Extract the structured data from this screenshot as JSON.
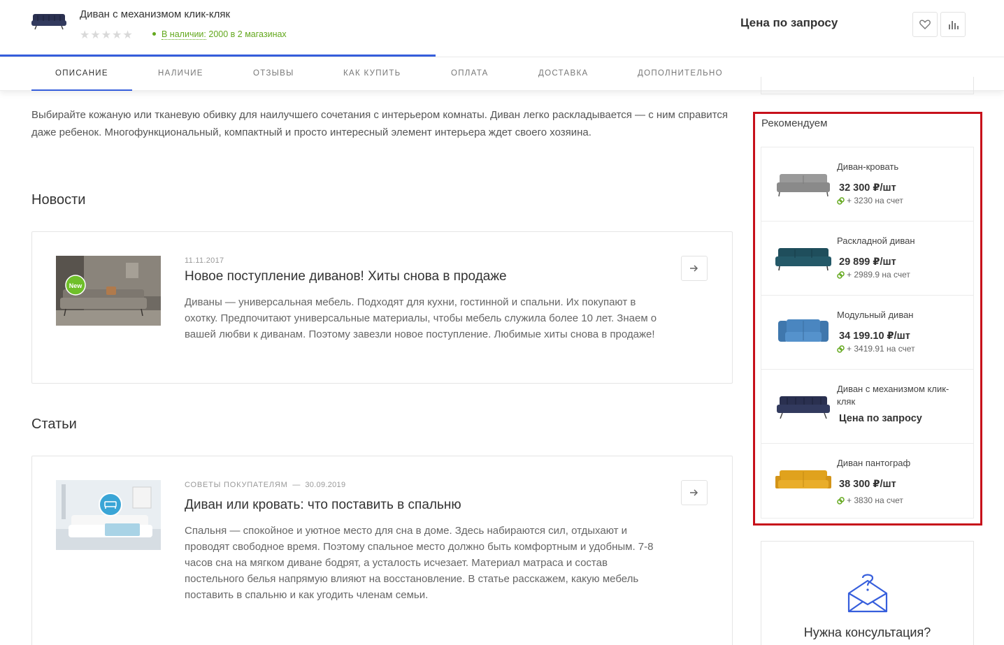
{
  "header": {
    "product_title": "Диван с механизмом клик-кляк",
    "rating_stars": "★★★★★",
    "stock_link": "В наличии:",
    "stock_rest": "2000 в 2 магазинах",
    "price": "Цена по запросу",
    "favorite_icon": "heart-icon",
    "compare_icon": "bar-chart-icon",
    "accent_color": "#365edc"
  },
  "tabs": [
    {
      "label": "ОПИСАНИЕ"
    },
    {
      "label": "НАЛИЧИЕ"
    },
    {
      "label": "ОТЗЫВЫ"
    },
    {
      "label": "КАК КУПИТЬ"
    },
    {
      "label": "ОПЛАТА"
    },
    {
      "label": "ДОСТАВКА"
    },
    {
      "label": "ДОПОЛНИТЕЛЬНО"
    }
  ],
  "description": "Выбирайте кожаную или тканевую обивку для наилучшего сочетания с интерьером комнаты. Диван легко раскладывается — с ним справится даже ребенок. Многофункциональный, компактный и просто интересный элемент интерьера ждет своего хозяина.",
  "news": {
    "heading": "Новости",
    "item": {
      "date": "11.11.2017",
      "badge": "New",
      "title": "Новое поступление диванов! Хиты снова в продаже",
      "text": "Диваны — универсальная мебель. Подходят для кухни, гостинной и спальни. Их покупают в охотку. Предпочитают универсальные материалы, чтобы мебель служила более 10 лет. Знаем о вашей любви к диванам. Поэтому завезли новое поступление. Любимые хиты снова в продаже!"
    }
  },
  "articles": {
    "heading": "Статьи",
    "item": {
      "section": "Советы покупателям",
      "separator": "—",
      "date": "30.09.2019",
      "title": "Диван или кровать: что поставить в спальню",
      "text": "Спальня — спокойное и уютное место для сна в доме. Здесь набираются сил, отдыхают и проводят свободное время. Поэтому спальное место должно быть комфортным и удобным. 7-8 часов сна на мягком диване бодрят, а усталость исчезает. Материал матраса и состав постельного белья напрямую влияют на восстановление. В статье расскажем, какую мебель поставить в спальню и как угодить членам семьи."
    }
  },
  "sidebar": {
    "recommend_title": "Рекомендуем",
    "items": [
      {
        "name": "Диван-кровать",
        "price": "32 300 ₽/шт",
        "bonus": "+ 3230 на счет",
        "color": "#9a9a9a"
      },
      {
        "name": "Раскладной диван",
        "price": "29 899 ₽/шт",
        "bonus": "+ 2989.9 на счет",
        "color": "#1f4e5c"
      },
      {
        "name": "Модульный диван",
        "price": "34 199.10 ₽/шт",
        "bonus": "+ 3419.91 на счет",
        "color": "#4a86c0"
      },
      {
        "name": "Диван с механизмом клик-кляк",
        "price": "Цена по запросу",
        "bonus": "",
        "color": "#2a3050"
      },
      {
        "name": "Диван пантограф",
        "price": "38 300 ₽/шт",
        "bonus": "+ 3830 на счет",
        "color": "#e0a21d"
      }
    ],
    "consult_title": "Нужна консультация?"
  }
}
